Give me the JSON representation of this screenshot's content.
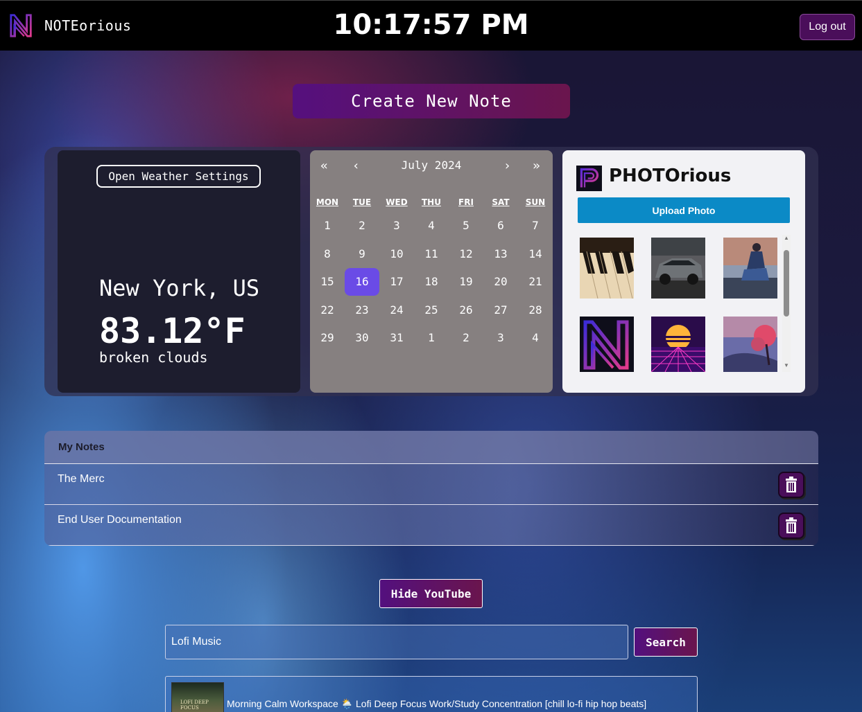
{
  "header": {
    "app_name": "NOTEorious",
    "clock": "10:17:57 PM",
    "logout_label": "Log out"
  },
  "create_note_label": "Create New Note",
  "weather": {
    "settings_label": "Open Weather Settings",
    "city": "New York, US",
    "temperature": "83.12°F",
    "description": "broken clouds"
  },
  "calendar": {
    "month_label": "July 2024",
    "nav": {
      "prev_year": "«",
      "prev_month": "‹",
      "next_month": "›",
      "next_year": "»"
    },
    "weekdays": [
      "MON",
      "TUE",
      "WED",
      "THU",
      "FRI",
      "SAT",
      "SUN"
    ],
    "weeks": [
      [
        "1",
        "2",
        "3",
        "4",
        "5",
        "6",
        "7"
      ],
      [
        "8",
        "9",
        "10",
        "11",
        "12",
        "13",
        "14"
      ],
      [
        "15",
        "16",
        "17",
        "18",
        "19",
        "20",
        "21"
      ],
      [
        "22",
        "23",
        "24",
        "25",
        "26",
        "27",
        "28"
      ],
      [
        "29",
        "30",
        "31",
        "1",
        "2",
        "3",
        "4"
      ]
    ],
    "today": "16"
  },
  "photos": {
    "title": "PHOTOrious",
    "upload_label": "Upload Photo",
    "items": [
      "piano-keys",
      "gray-suv",
      "person-on-wall",
      "noteorious-logo",
      "synthwave-sunset",
      "pink-tree-landscape"
    ]
  },
  "notes": {
    "header": "My Notes",
    "items": [
      {
        "title": "The Merc"
      },
      {
        "title": "End User Documentation"
      }
    ]
  },
  "youtube": {
    "hide_label": "Hide YouTube",
    "search_value": "Lofi Music",
    "search_label": "Search",
    "results": [
      {
        "title": "Morning Calm Workspace 🌦️ Lofi Deep Focus Work/Study Concentration [chill lo-fi hip hop beats]",
        "thumb_text": "LOFI DEEP FOCUS"
      }
    ]
  },
  "colors": {
    "accent_purple": "#4a0e5a",
    "today_highlight": "#6a4be6",
    "upload_blue": "#0b8ac6",
    "calendar_bg": "#868080"
  }
}
